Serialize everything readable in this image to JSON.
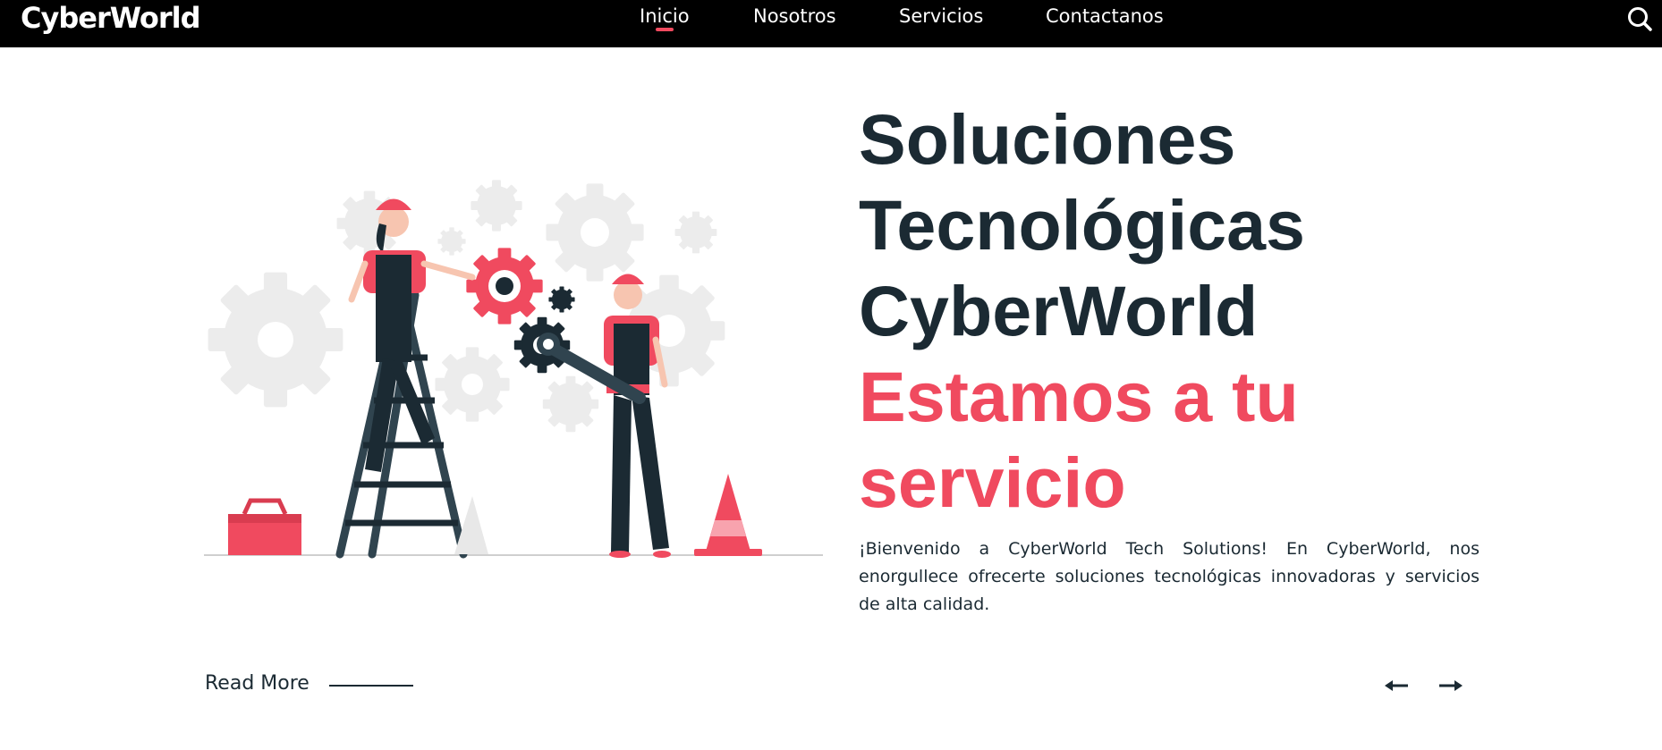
{
  "nav": {
    "brand": "CyberWorld",
    "items": [
      {
        "label": "Inicio",
        "active": true
      },
      {
        "label": "Nosotros",
        "active": false
      },
      {
        "label": "Servicios",
        "active": false
      },
      {
        "label": "Contactanos",
        "active": false
      }
    ],
    "search_icon": "search-icon"
  },
  "hero": {
    "title_lines": [
      "Soluciones",
      "Tecnológicas",
      "CyberWorld"
    ],
    "accent_lines": [
      "Estamos a tu",
      "servicio"
    ],
    "intro": "¡Bienvenido a CyberWorld Tech Solutions! En CyberWorld, nos enorgullece ofrecerte soluciones tecnológicas innovadoras y servicios de alta calidad.",
    "read_more": "Read More",
    "prev_icon": "arrow-left-icon",
    "next_icon": "arrow-right-icon"
  },
  "colors": {
    "navbar": "#000000",
    "accent": "#f04a5f",
    "dark": "#1b2a33",
    "gear_gray": "#e3e3e3"
  }
}
